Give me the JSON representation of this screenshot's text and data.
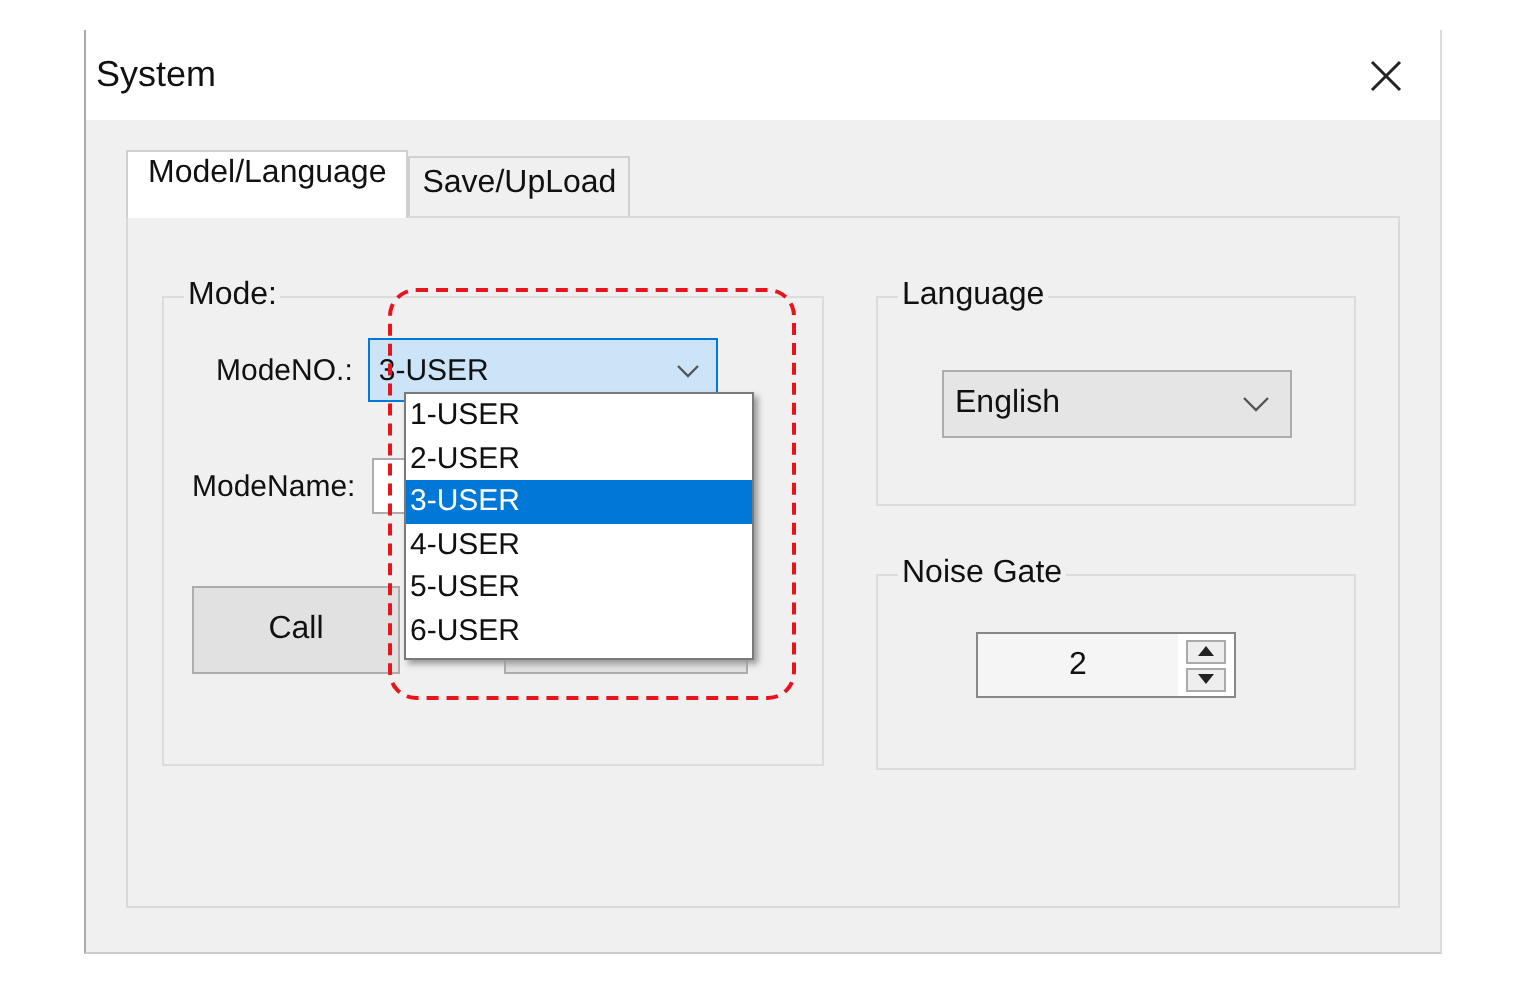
{
  "window": {
    "title": "System"
  },
  "tabs": [
    {
      "label": "Model/Language",
      "selected": true
    },
    {
      "label": "Save/UpLoad",
      "selected": false
    }
  ],
  "mode_group": {
    "title": "Mode:",
    "mode_no": {
      "label": "ModeNO.:",
      "value": "3-USER",
      "expanded": true,
      "options": [
        {
          "label": "1-USER",
          "selected": false
        },
        {
          "label": "2-USER",
          "selected": false
        },
        {
          "label": "3-USER",
          "selected": true
        },
        {
          "label": "4-USER",
          "selected": false
        },
        {
          "label": "5-USER",
          "selected": false
        },
        {
          "label": "6-USER",
          "selected": false
        }
      ]
    },
    "mode_name": {
      "label": "ModeName:"
    },
    "call_button": {
      "label": "Call"
    }
  },
  "language_group": {
    "title": "Language",
    "value": "English"
  },
  "noise_gate_group": {
    "title": "Noise Gate",
    "value": "2"
  }
}
